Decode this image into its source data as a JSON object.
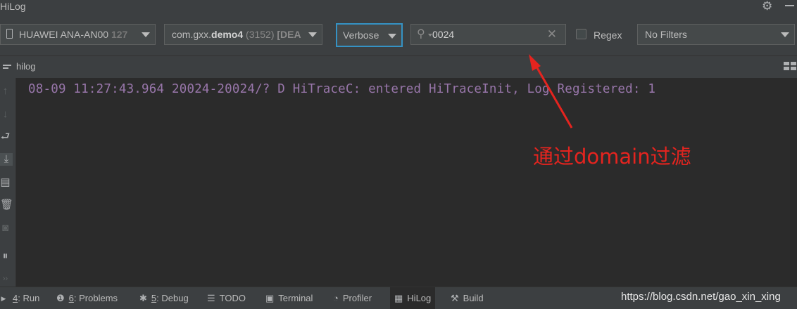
{
  "window": {
    "title": "HiLog"
  },
  "toolbar": {
    "device": {
      "name": "HUAWEI ANA-AN00",
      "serial": "127"
    },
    "process": {
      "package_prefix": "com.gxx.",
      "package_name": "demo4",
      "pid": "(3152)",
      "tag": "[DEA"
    },
    "log_level": "Verbose",
    "search": {
      "value": "0024"
    },
    "regex_label": "Regex",
    "regex_checked": false,
    "filter": "No Filters"
  },
  "panel": {
    "name": "hilog"
  },
  "log": {
    "lines": [
      "08-09 11:27:43.964 20024-20024/? D HiTraceC: entered HiTraceInit, Log Registered: 1"
    ],
    "color": "#9876aa"
  },
  "annotation": {
    "text": "通过domain过滤",
    "color": "#e5241f"
  },
  "statusbar": {
    "tools": [
      {
        "icon": "run-icon",
        "key": "4",
        "label": ": Run"
      },
      {
        "icon": "problems-icon",
        "key": "6",
        "label": ": Problems"
      },
      {
        "icon": "debug-icon",
        "key": "5",
        "label": ": Debug"
      },
      {
        "icon": "todo-icon",
        "label": "TODO"
      },
      {
        "icon": "terminal-icon",
        "label": "Terminal"
      },
      {
        "icon": "profiler-icon",
        "label": "Profiler"
      },
      {
        "icon": "hilog-icon",
        "label": "HiLog"
      },
      {
        "icon": "build-icon",
        "label": "Build"
      }
    ],
    "watermark": "https://blog.csdn.net/gao_xin_xing"
  }
}
